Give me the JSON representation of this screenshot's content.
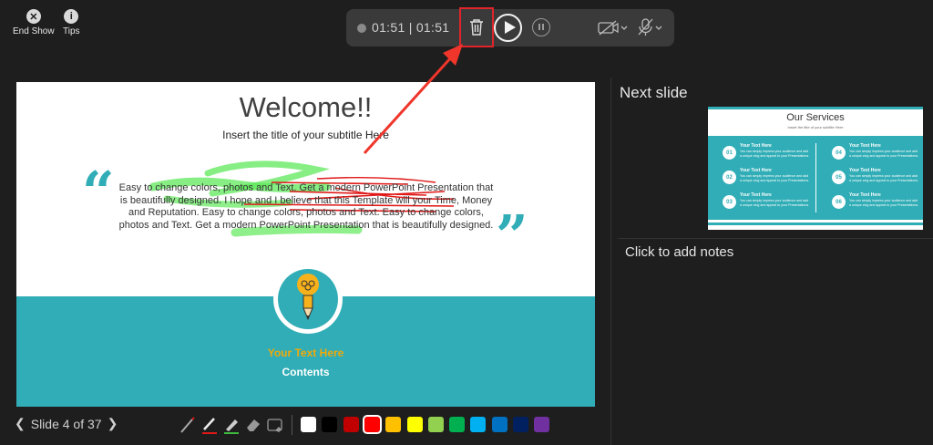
{
  "top_left": {
    "end_show_label": "End Show",
    "end_show_icon": "close-circle-icon",
    "tips_label": "Tips",
    "tips_icon": "info-circle-icon"
  },
  "toolbar": {
    "timer": "01:51 | 01:51",
    "icons": [
      "record-indicator-icon",
      "trash-icon",
      "play-icon",
      "pause-icon",
      "camera-off-icon",
      "microphone-off-icon"
    ]
  },
  "slide": {
    "title": "Welcome!!",
    "subtitle": "Insert the title of your subtitle Here",
    "body": "Easy to change colors, photos and Text. Get a modern PowerPoint  Presentation that is beautifully designed. I hope and I believe that this Template will your Time, Money and Reputation. Easy to change colors, photos and Text. Easy to change colors, photos and Text. Get a modern PowerPoint  Presentation that is beautifully designed.",
    "quote_open": "“",
    "quote_close": "”",
    "your_text": "Your Text  Here",
    "contents": "Contents",
    "colors": {
      "teal": "#30adb6",
      "orange": "#f0a90a"
    }
  },
  "bottom": {
    "prev_icon": "❮",
    "slide_label": "Slide 4 of 37",
    "next_icon": "❯",
    "tools": [
      "laser-pointer-icon",
      "pen-icon",
      "highlighter-icon",
      "eraser-icon",
      "erase-all-icon"
    ],
    "swatches": [
      "#ffffff",
      "#000000",
      "#c00000",
      "#ff0000",
      "#ffc000",
      "#ffff00",
      "#92d050",
      "#00b050",
      "#00b0f0",
      "#0070c0",
      "#002060",
      "#7030a0"
    ],
    "selected_swatch": 3
  },
  "right": {
    "next_slide_label": "Next slide",
    "next_slide": {
      "title": "Our Services",
      "subtitle": "Insert the title of your subtitle Here",
      "items": [
        {
          "num": "01",
          "heading": "Your Text  Here",
          "desc": "You can simply impress your audience and add a unique zing and appeal to your Presentations."
        },
        {
          "num": "02",
          "heading": "Your Text  Here",
          "desc": "You can simply impress your audience and add a unique zing and appeal to your Presentations."
        },
        {
          "num": "03",
          "heading": "Your Text  Here",
          "desc": "You can simply impress your audience and add a unique zing and appeal to your Presentations."
        },
        {
          "num": "04",
          "heading": "Your Text  Here",
          "desc": "You can simply impress your audience and add a unique zing and appeal to your Presentations."
        },
        {
          "num": "05",
          "heading": "Your Text  Here",
          "desc": "You can simply impress your audience and add a unique zing and appeal to your Presentations."
        },
        {
          "num": "06",
          "heading": "Your Text  Here",
          "desc": "You can simply impress your audience and add a unique zing and appeal to your Presentations."
        }
      ]
    },
    "notes_placeholder": "Click to add notes"
  },
  "annotation": {
    "arrow_color": "#f0352b",
    "highlight_box_color": "#e0242a"
  }
}
